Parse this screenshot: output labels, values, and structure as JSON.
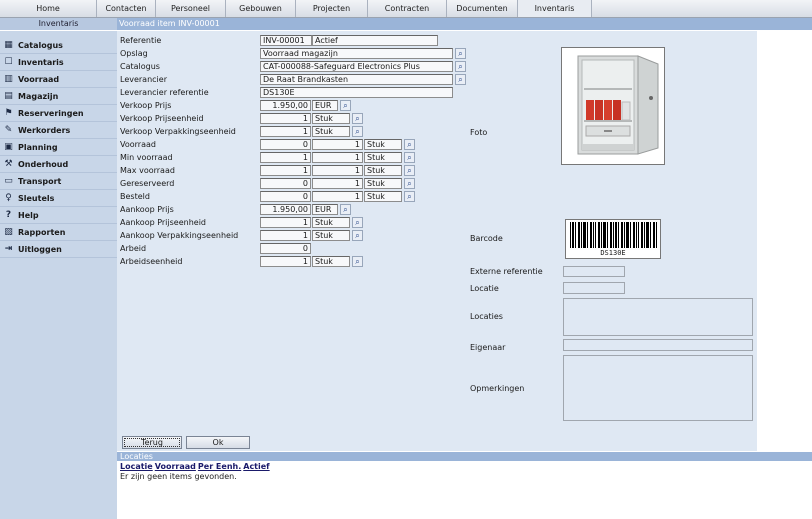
{
  "topnav": {
    "tabs": [
      "Home",
      "Contacten",
      "Personeel",
      "Gebouwen",
      "Projecten",
      "Contracten",
      "Documenten",
      "Inventaris"
    ]
  },
  "subbar": {
    "section": "Inventaris",
    "title": "Voorraad item INV-00001"
  },
  "sidebar": {
    "items": [
      {
        "label": "Catalogus",
        "icon": "catalog-icon"
      },
      {
        "label": "Inventaris",
        "icon": "inventory-icon"
      },
      {
        "label": "Voorraad",
        "icon": "stock-grid-icon"
      },
      {
        "label": "Magazijn",
        "icon": "warehouse-icon"
      },
      {
        "label": "Reserveringen",
        "icon": "reservations-icon"
      },
      {
        "label": "Werkorders",
        "icon": "workorders-icon"
      },
      {
        "label": "Planning",
        "icon": "planning-icon"
      },
      {
        "label": "Onderhoud",
        "icon": "maintenance-icon"
      },
      {
        "label": "Transport",
        "icon": "transport-icon"
      },
      {
        "label": "Sleutels",
        "icon": "key-icon"
      },
      {
        "label": "Help",
        "icon": "help-icon"
      },
      {
        "label": "Rapporten",
        "icon": "reports-icon"
      },
      {
        "label": "Uitloggen",
        "icon": "logout-icon"
      }
    ]
  },
  "form": {
    "referentie": {
      "label": "Referentie",
      "value": "INV-00001",
      "status": "Actief"
    },
    "opslag": {
      "label": "Opslag",
      "value": "Voorraad magazijn"
    },
    "catalogus": {
      "label": "Catalogus",
      "value": "CAT-000088-Safeguard Electronics Plus"
    },
    "leverancier": {
      "label": "Leverancier",
      "value": "De Raat Brandkasten"
    },
    "leverancier_ref": {
      "label": "Leverancier referentie",
      "value": "DS130E"
    },
    "verkoop_prijs": {
      "label": "Verkoop Prijs",
      "value": "1.950,00",
      "currency": "EUR"
    },
    "verkoop_prijseenheid": {
      "label": "Verkoop Prijseenheid",
      "qty": "1",
      "unit": "Stuk"
    },
    "verkoop_verpakking": {
      "label": "Verkoop Verpakkingseenheid",
      "qty": "1",
      "unit": "Stuk"
    },
    "voorraad": {
      "label": "Voorraad",
      "qty": "0",
      "per": "1",
      "unit": "Stuk"
    },
    "min_voorraad": {
      "label": "Min voorraad",
      "qty": "1",
      "per": "1",
      "unit": "Stuk"
    },
    "max_voorraad": {
      "label": "Max voorraad",
      "qty": "1",
      "per": "1",
      "unit": "Stuk"
    },
    "gereserveerd": {
      "label": "Gereserveerd",
      "qty": "0",
      "per": "1",
      "unit": "Stuk"
    },
    "besteld": {
      "label": "Besteld",
      "qty": "0",
      "per": "1",
      "unit": "Stuk"
    },
    "aankoop_prijs": {
      "label": "Aankoop Prijs",
      "value": "1.950,00",
      "currency": "EUR"
    },
    "aankoop_prijseenheid": {
      "label": "Aankoop Prijseenheid",
      "qty": "1",
      "unit": "Stuk"
    },
    "aankoop_verpakking": {
      "label": "Aankoop Verpakkingseenheid",
      "qty": "1",
      "unit": "Stuk"
    },
    "arbeid": {
      "label": "Arbeid",
      "value": "0"
    },
    "arbeidseenheid": {
      "label": "Arbeidseenheid",
      "qty": "1",
      "unit": "Stuk"
    }
  },
  "right": {
    "foto_label": "Foto",
    "barcode_label": "Barcode",
    "barcode_text": "DS130E",
    "externe_ref_label": "Externe referentie",
    "locatie_label": "Locatie",
    "locaties_label": "Locaties",
    "eigenaar_label": "Eigenaar",
    "opmerkingen_label": "Opmerkingen"
  },
  "buttons": {
    "back": "Terug",
    "ok": "Ok"
  },
  "locaties": {
    "title": "Locaties",
    "columns": [
      "Locatie",
      "Voorraad",
      "Per Eenh.",
      "Actief"
    ],
    "empty": "Er zijn geen items gevonden."
  }
}
